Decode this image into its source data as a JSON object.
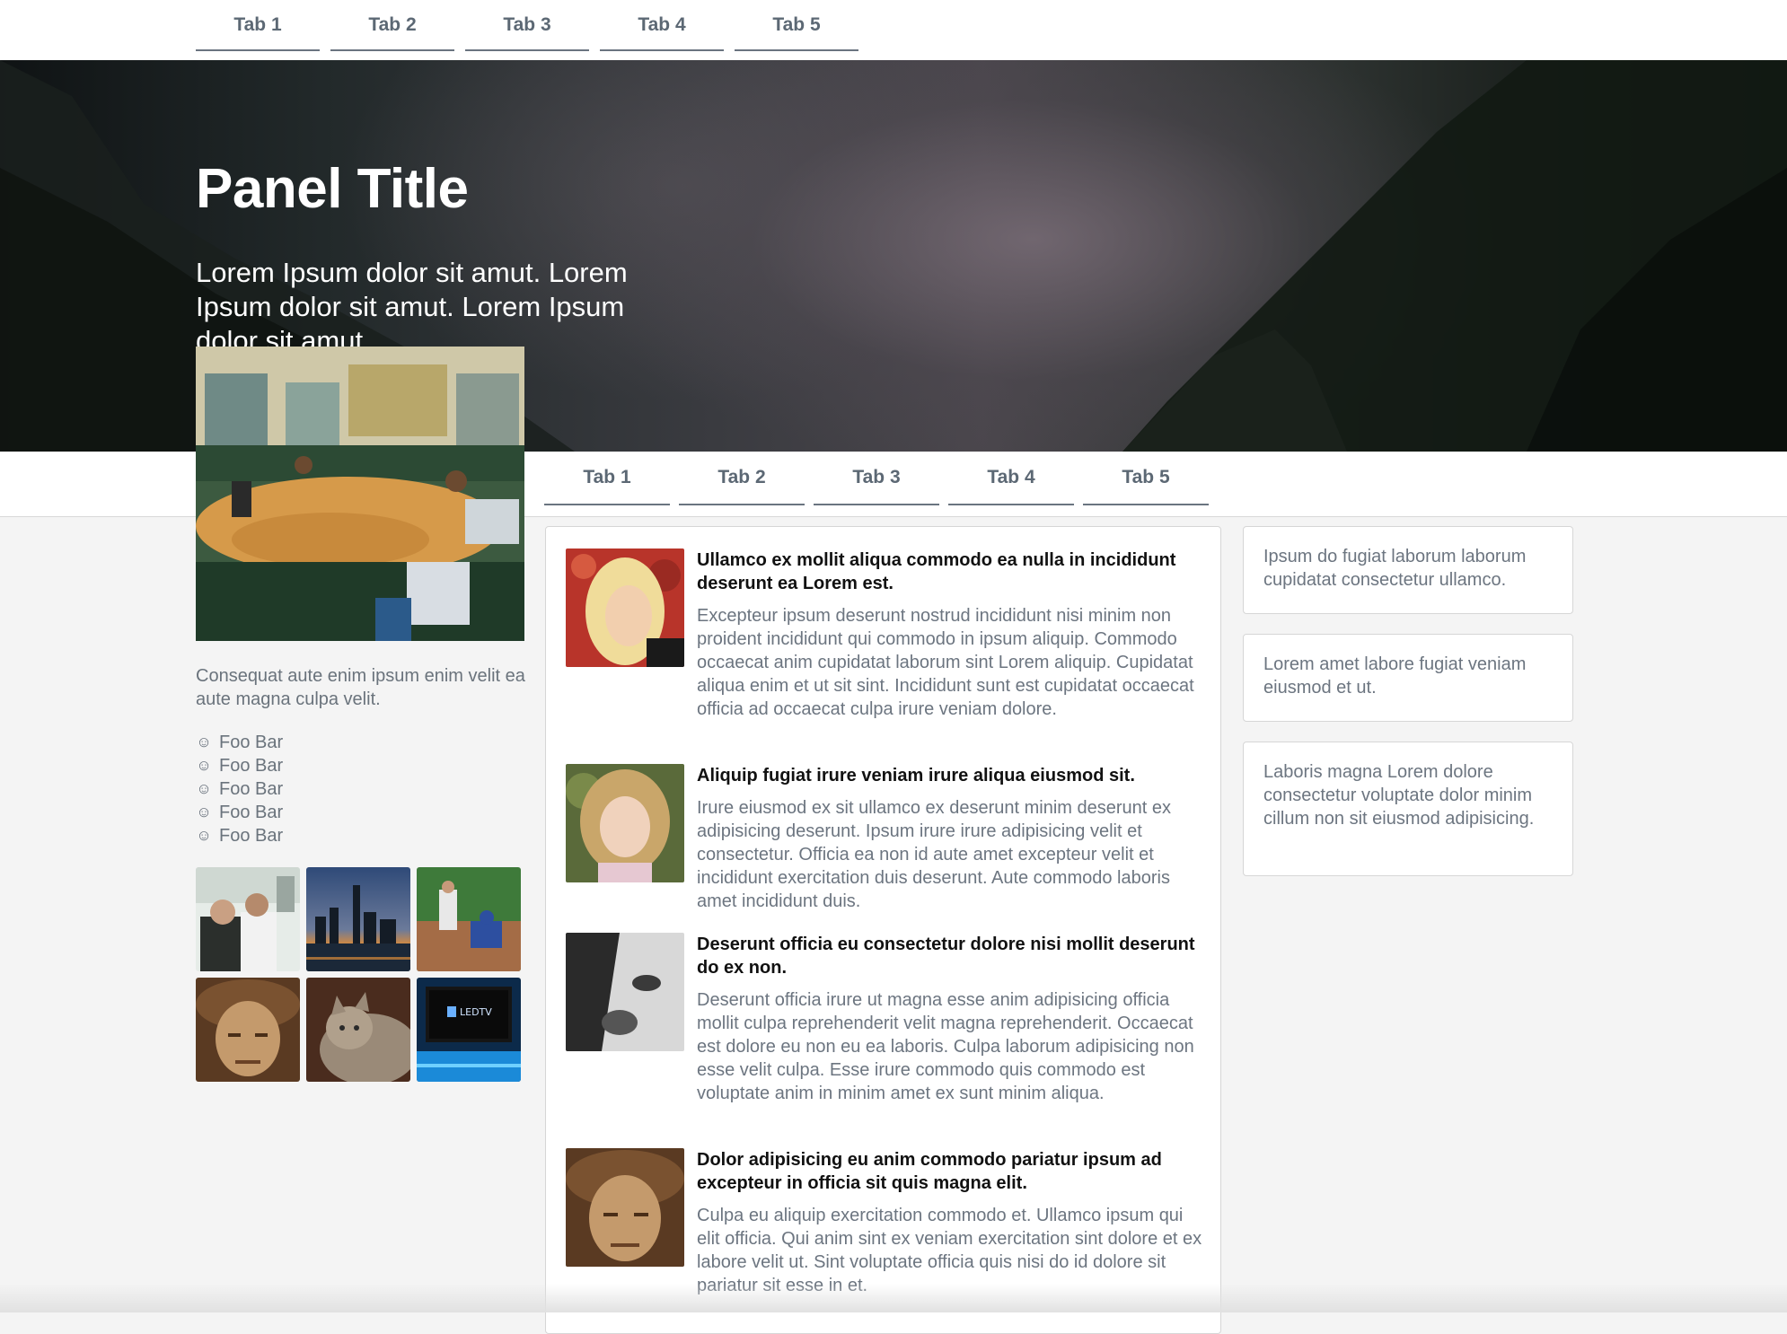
{
  "top_tabs": [
    "Tab 1",
    "Tab 2",
    "Tab 3",
    "Tab 4",
    "Tab 5"
  ],
  "hero": {
    "title": "Panel Title",
    "lead": "Lorem Ipsum dolor sit amut. Lorem Ipsum dolor sit amut. Lorem Ipsum dolor sit amut."
  },
  "content_tabs": [
    "Tab 1",
    "Tab 2",
    "Tab 3",
    "Tab 4",
    "Tab 5"
  ],
  "sidebar": {
    "text": "Consequat aute enim ipsum enim velit ea aute magna culpa velit.",
    "items": [
      "Foo Bar",
      "Foo Bar",
      "Foo Bar",
      "Foo Bar",
      "Foo Bar"
    ],
    "item_icon": "smiley-icon"
  },
  "articles": [
    {
      "title": "Ullamco ex mollit aliqua commodo ea nulla in incididunt deserunt ea Lorem est.",
      "body": "Excepteur ipsum deserunt nostrud incididunt nisi minim non proident incididunt qui commodo in ipsum aliquip. Commodo occaecat anim cupidatat laborum sint Lorem aliquip. Cupidatat aliqua enim et ut sit sint. Incididunt sunt est cupidatat occaecat officia ad occaecat culpa irure veniam dolore."
    },
    {
      "title": "Aliquip fugiat irure veniam irure aliqua eiusmod sit.",
      "body": "Irure eiusmod ex sit ullamco ex deserunt minim deserunt ex adipisicing deserunt. Ipsum irure irure adipisicing velit et consectetur. Officia ea non id aute amet excepteur velit et incididunt exercitation duis deserunt. Aute commodo laboris amet incididunt duis."
    },
    {
      "title": "Deserunt officia eu consectetur dolore nisi mollit deserunt do ex non.",
      "body": "Deserunt officia irure ut magna esse anim adipisicing officia mollit culpa reprehenderit velit magna reprehenderit. Occaecat est dolore eu non eu ea laboris. Culpa laborum adipisicing non esse velit culpa. Esse irure commodo quis commodo est voluptate anim in minim amet ex sunt minim aliqua."
    },
    {
      "title": "Dolor adipisicing eu anim commodo pariatur ipsum ad excepteur in officia sit quis magna elit.",
      "body": "Culpa eu aliquip exercitation commodo et. Ullamco ipsum qui elit officia. Qui anim sint ex veniam exercitation sint dolore et ex labore velit ut. Sint voluptate officia quis nisi do id dolore sit pariatur sit esse in et."
    }
  ],
  "side_boxes": [
    "Ipsum do fugiat laborum laborum cupidatat consectetur ullamco.",
    "Lorem amet labore fugiat veniam eiusmod et ut.",
    "Laboris magna Lorem dolore consectetur voluptate dolor minim cillum non sit eiusmod adipisicing."
  ],
  "thumb_image_text": "LEDTV"
}
